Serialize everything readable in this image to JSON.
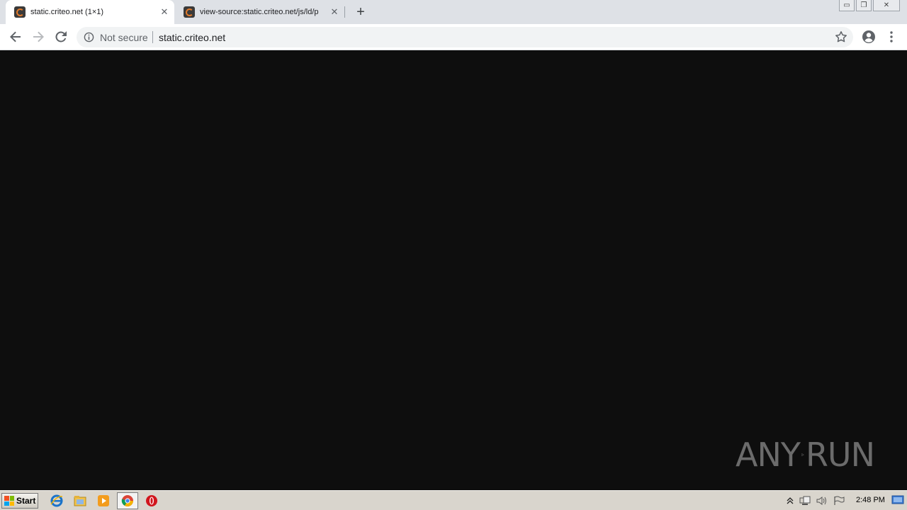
{
  "browser": {
    "tabs": [
      {
        "title": "static.criteo.net (1×1)",
        "active": true
      },
      {
        "title": "view-source:static.criteo.net/js/ld/p",
        "active": false
      }
    ],
    "tab_close_glyph": "✕",
    "new_tab_glyph": "+",
    "window_controls": {
      "minimize": "▭",
      "restore": "❐",
      "close": "✕"
    },
    "toolbar": {
      "security_label": "Not secure",
      "url": "static.criteo.net"
    }
  },
  "watermark": {
    "left_text": "ANY",
    "right_text": "RUN"
  },
  "taskbar": {
    "start_label": "Start",
    "pinned": [
      "internet-explorer-icon",
      "file-explorer-icon",
      "media-player-icon",
      "chrome-icon",
      "opera-icon"
    ],
    "clock": "2:48 PM"
  },
  "colors": {
    "page_background": "#0e0e0e",
    "tabstrip": "#dee1e6",
    "favicon_accent": "#e27a2b",
    "watermark": "#6b6b6b",
    "taskbar": "#d9d5cd"
  }
}
